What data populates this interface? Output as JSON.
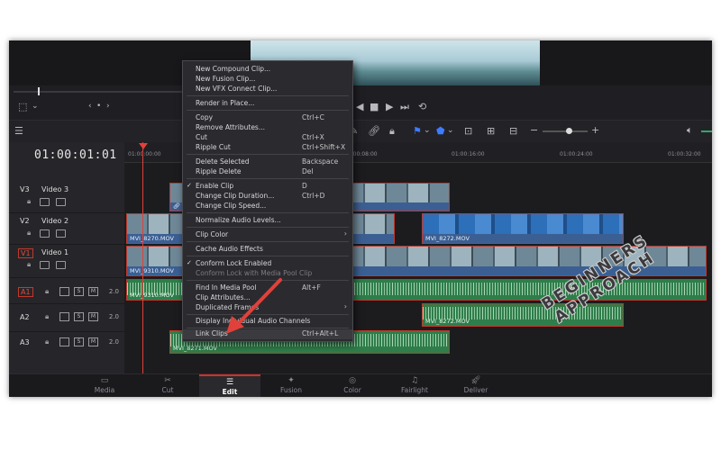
{
  "viewer": {
    "timecode": "01:00:01:01"
  },
  "ruler": {
    "labels": [
      "01:00:00:00",
      "01:00:08:00",
      "01:00:16:00",
      "01:00:24:00",
      "01:00:32:00"
    ]
  },
  "tracks": {
    "video": [
      {
        "id": "V3",
        "name": "Video 3"
      },
      {
        "id": "V2",
        "name": "Video 2"
      },
      {
        "id": "V1",
        "name": "Video 1"
      }
    ],
    "audio": [
      {
        "id": "A1",
        "volume": "2.0"
      },
      {
        "id": "A2",
        "volume": "2.0"
      },
      {
        "id": "A3",
        "volume": "2.0"
      }
    ],
    "button_s": "S",
    "button_m": "M"
  },
  "clips": {
    "v2_a": "MVI_8270.MOV",
    "v2_b": "MVI_8272.MOV",
    "v1": "MVI_9310.MOV",
    "a1": "MVI_9310.MOV",
    "a2": "MVI_8272.MOV",
    "a3": "MVI_8271.MOV"
  },
  "context_menu": [
    {
      "label": "New Compound Clip...",
      "shortcut": ""
    },
    {
      "label": "New Fusion Clip...",
      "shortcut": ""
    },
    {
      "label": "New VFX Connect Clip...",
      "shortcut": ""
    },
    {
      "label": "Render in Place...",
      "shortcut": ""
    },
    {
      "label": "Copy",
      "shortcut": "Ctrl+C"
    },
    {
      "label": "Remove Attributes...",
      "shortcut": ""
    },
    {
      "label": "Cut",
      "shortcut": "Ctrl+X"
    },
    {
      "label": "Ripple Cut",
      "shortcut": "Ctrl+Shift+X"
    },
    {
      "label": "Delete Selected",
      "shortcut": "Backspace"
    },
    {
      "label": "Ripple Delete",
      "shortcut": "Del"
    },
    {
      "label": "Enable Clip",
      "shortcut": "D"
    },
    {
      "label": "Change Clip Duration...",
      "shortcut": "Ctrl+D"
    },
    {
      "label": "Change Clip Speed...",
      "shortcut": ""
    },
    {
      "label": "Normalize Audio Levels...",
      "shortcut": ""
    },
    {
      "label": "Clip Color",
      "shortcut": ""
    },
    {
      "label": "Cache Audio Effects",
      "shortcut": ""
    },
    {
      "label": "Conform Lock Enabled",
      "shortcut": ""
    },
    {
      "label": "Conform Lock with Media Pool Clip",
      "shortcut": ""
    },
    {
      "label": "Find In Media Pool",
      "shortcut": "Alt+F"
    },
    {
      "label": "Clip Attributes...",
      "shortcut": ""
    },
    {
      "label": "Duplicated Frames",
      "shortcut": ""
    },
    {
      "label": "Display Individual Audio Channels",
      "shortcut": ""
    },
    {
      "label": "Link Clips",
      "shortcut": "Ctrl+Alt+L"
    }
  ],
  "pages": [
    "Media",
    "Cut",
    "Edit",
    "Fusion",
    "Color",
    "Fairlight",
    "Deliver"
  ],
  "active_page": "Edit",
  "watermark": {
    "line1": "BEGINNERS",
    "line2": "APPROACH"
  },
  "colors": {
    "selection_red": "#c0392b",
    "video_clip_blue": "#3b5f93",
    "audio_clip_green": "#2f7d4a",
    "playhead": "#e0413a"
  },
  "icons": [
    "play-icon",
    "stop-icon",
    "skip-forward-icon",
    "loop-icon",
    "link-icon",
    "lock-icon",
    "flag-icon",
    "marker-icon",
    "zoom-icon",
    "volume-icon"
  ]
}
